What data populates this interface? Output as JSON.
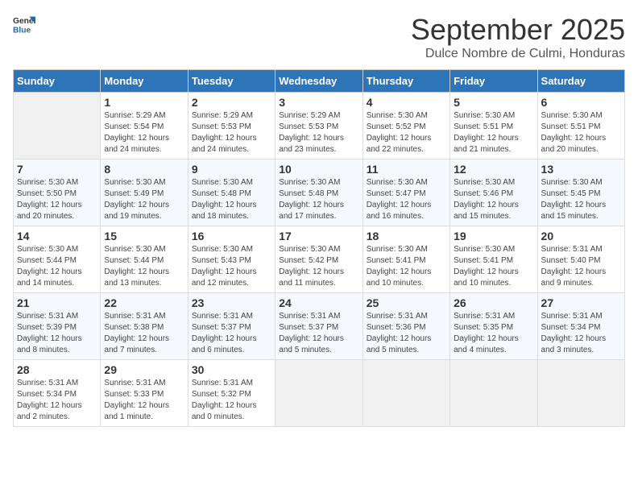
{
  "header": {
    "logo_general": "General",
    "logo_blue": "Blue",
    "month_title": "September 2025",
    "location": "Dulce Nombre de Culmi, Honduras"
  },
  "days_of_week": [
    "Sunday",
    "Monday",
    "Tuesday",
    "Wednesday",
    "Thursday",
    "Friday",
    "Saturday"
  ],
  "weeks": [
    [
      {
        "day": "",
        "info": ""
      },
      {
        "day": "1",
        "info": "Sunrise: 5:29 AM\nSunset: 5:54 PM\nDaylight: 12 hours\nand 24 minutes."
      },
      {
        "day": "2",
        "info": "Sunrise: 5:29 AM\nSunset: 5:53 PM\nDaylight: 12 hours\nand 24 minutes."
      },
      {
        "day": "3",
        "info": "Sunrise: 5:29 AM\nSunset: 5:53 PM\nDaylight: 12 hours\nand 23 minutes."
      },
      {
        "day": "4",
        "info": "Sunrise: 5:30 AM\nSunset: 5:52 PM\nDaylight: 12 hours\nand 22 minutes."
      },
      {
        "day": "5",
        "info": "Sunrise: 5:30 AM\nSunset: 5:51 PM\nDaylight: 12 hours\nand 21 minutes."
      },
      {
        "day": "6",
        "info": "Sunrise: 5:30 AM\nSunset: 5:51 PM\nDaylight: 12 hours\nand 20 minutes."
      }
    ],
    [
      {
        "day": "7",
        "info": "Sunrise: 5:30 AM\nSunset: 5:50 PM\nDaylight: 12 hours\nand 20 minutes."
      },
      {
        "day": "8",
        "info": "Sunrise: 5:30 AM\nSunset: 5:49 PM\nDaylight: 12 hours\nand 19 minutes."
      },
      {
        "day": "9",
        "info": "Sunrise: 5:30 AM\nSunset: 5:48 PM\nDaylight: 12 hours\nand 18 minutes."
      },
      {
        "day": "10",
        "info": "Sunrise: 5:30 AM\nSunset: 5:48 PM\nDaylight: 12 hours\nand 17 minutes."
      },
      {
        "day": "11",
        "info": "Sunrise: 5:30 AM\nSunset: 5:47 PM\nDaylight: 12 hours\nand 16 minutes."
      },
      {
        "day": "12",
        "info": "Sunrise: 5:30 AM\nSunset: 5:46 PM\nDaylight: 12 hours\nand 15 minutes."
      },
      {
        "day": "13",
        "info": "Sunrise: 5:30 AM\nSunset: 5:45 PM\nDaylight: 12 hours\nand 15 minutes."
      }
    ],
    [
      {
        "day": "14",
        "info": "Sunrise: 5:30 AM\nSunset: 5:44 PM\nDaylight: 12 hours\nand 14 minutes."
      },
      {
        "day": "15",
        "info": "Sunrise: 5:30 AM\nSunset: 5:44 PM\nDaylight: 12 hours\nand 13 minutes."
      },
      {
        "day": "16",
        "info": "Sunrise: 5:30 AM\nSunset: 5:43 PM\nDaylight: 12 hours\nand 12 minutes."
      },
      {
        "day": "17",
        "info": "Sunrise: 5:30 AM\nSunset: 5:42 PM\nDaylight: 12 hours\nand 11 minutes."
      },
      {
        "day": "18",
        "info": "Sunrise: 5:30 AM\nSunset: 5:41 PM\nDaylight: 12 hours\nand 10 minutes."
      },
      {
        "day": "19",
        "info": "Sunrise: 5:30 AM\nSunset: 5:41 PM\nDaylight: 12 hours\nand 10 minutes."
      },
      {
        "day": "20",
        "info": "Sunrise: 5:31 AM\nSunset: 5:40 PM\nDaylight: 12 hours\nand 9 minutes."
      }
    ],
    [
      {
        "day": "21",
        "info": "Sunrise: 5:31 AM\nSunset: 5:39 PM\nDaylight: 12 hours\nand 8 minutes."
      },
      {
        "day": "22",
        "info": "Sunrise: 5:31 AM\nSunset: 5:38 PM\nDaylight: 12 hours\nand 7 minutes."
      },
      {
        "day": "23",
        "info": "Sunrise: 5:31 AM\nSunset: 5:37 PM\nDaylight: 12 hours\nand 6 minutes."
      },
      {
        "day": "24",
        "info": "Sunrise: 5:31 AM\nSunset: 5:37 PM\nDaylight: 12 hours\nand 5 minutes."
      },
      {
        "day": "25",
        "info": "Sunrise: 5:31 AM\nSunset: 5:36 PM\nDaylight: 12 hours\nand 5 minutes."
      },
      {
        "day": "26",
        "info": "Sunrise: 5:31 AM\nSunset: 5:35 PM\nDaylight: 12 hours\nand 4 minutes."
      },
      {
        "day": "27",
        "info": "Sunrise: 5:31 AM\nSunset: 5:34 PM\nDaylight: 12 hours\nand 3 minutes."
      }
    ],
    [
      {
        "day": "28",
        "info": "Sunrise: 5:31 AM\nSunset: 5:34 PM\nDaylight: 12 hours\nand 2 minutes."
      },
      {
        "day": "29",
        "info": "Sunrise: 5:31 AM\nSunset: 5:33 PM\nDaylight: 12 hours\nand 1 minute."
      },
      {
        "day": "30",
        "info": "Sunrise: 5:31 AM\nSunset: 5:32 PM\nDaylight: 12 hours\nand 0 minutes."
      },
      {
        "day": "",
        "info": ""
      },
      {
        "day": "",
        "info": ""
      },
      {
        "day": "",
        "info": ""
      },
      {
        "day": "",
        "info": ""
      }
    ]
  ]
}
